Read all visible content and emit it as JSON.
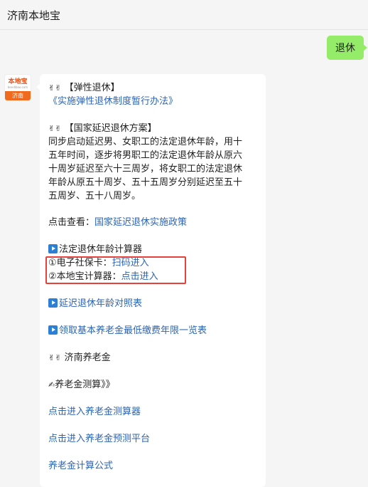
{
  "header": {
    "title": "济南本地宝"
  },
  "sent": {
    "text": "退休"
  },
  "avatar": {
    "brand": "本地宝",
    "sub": "bendibao.com",
    "city": "济南"
  },
  "message": {
    "s1_title": "【弹性退休】",
    "s1_link": "《实施弹性退休制度暂行办法》",
    "s2_title": "【国家延迟退休方案】",
    "para": [
      "同步启动延迟男、女职工的法定退休年龄，用十",
      "五年时间，逐步将男职工的法定退休年龄从原六",
      "十周岁延迟至六十三周岁，将女职工的法定退休",
      "年龄从原五十周岁、五十五周岁分别延迟至五十",
      "五周岁、五十八周岁。"
    ],
    "view_label": "点击查看：",
    "view_link": "国家延迟退休实施政策",
    "calc_title": "法定退休年龄计算器",
    "calc1_label": "①电子社保卡：",
    "calc1_link": "扫码进入",
    "calc2_label": "②本地宝计算器：",
    "calc2_link": "点击进入",
    "table1": "延迟退休年龄对照表",
    "table2": "领取基本养老金最低缴费年限一览表",
    "pension_title": "济南养老金",
    "pension_calc": "养老金测算》》",
    "link1": "点击进入养老金测算器",
    "link2": "点击进入养老金预测平台",
    "link3": "养老金计算公式"
  },
  "emoji": {
    "victory": "✌✌",
    "writing": "✍"
  }
}
